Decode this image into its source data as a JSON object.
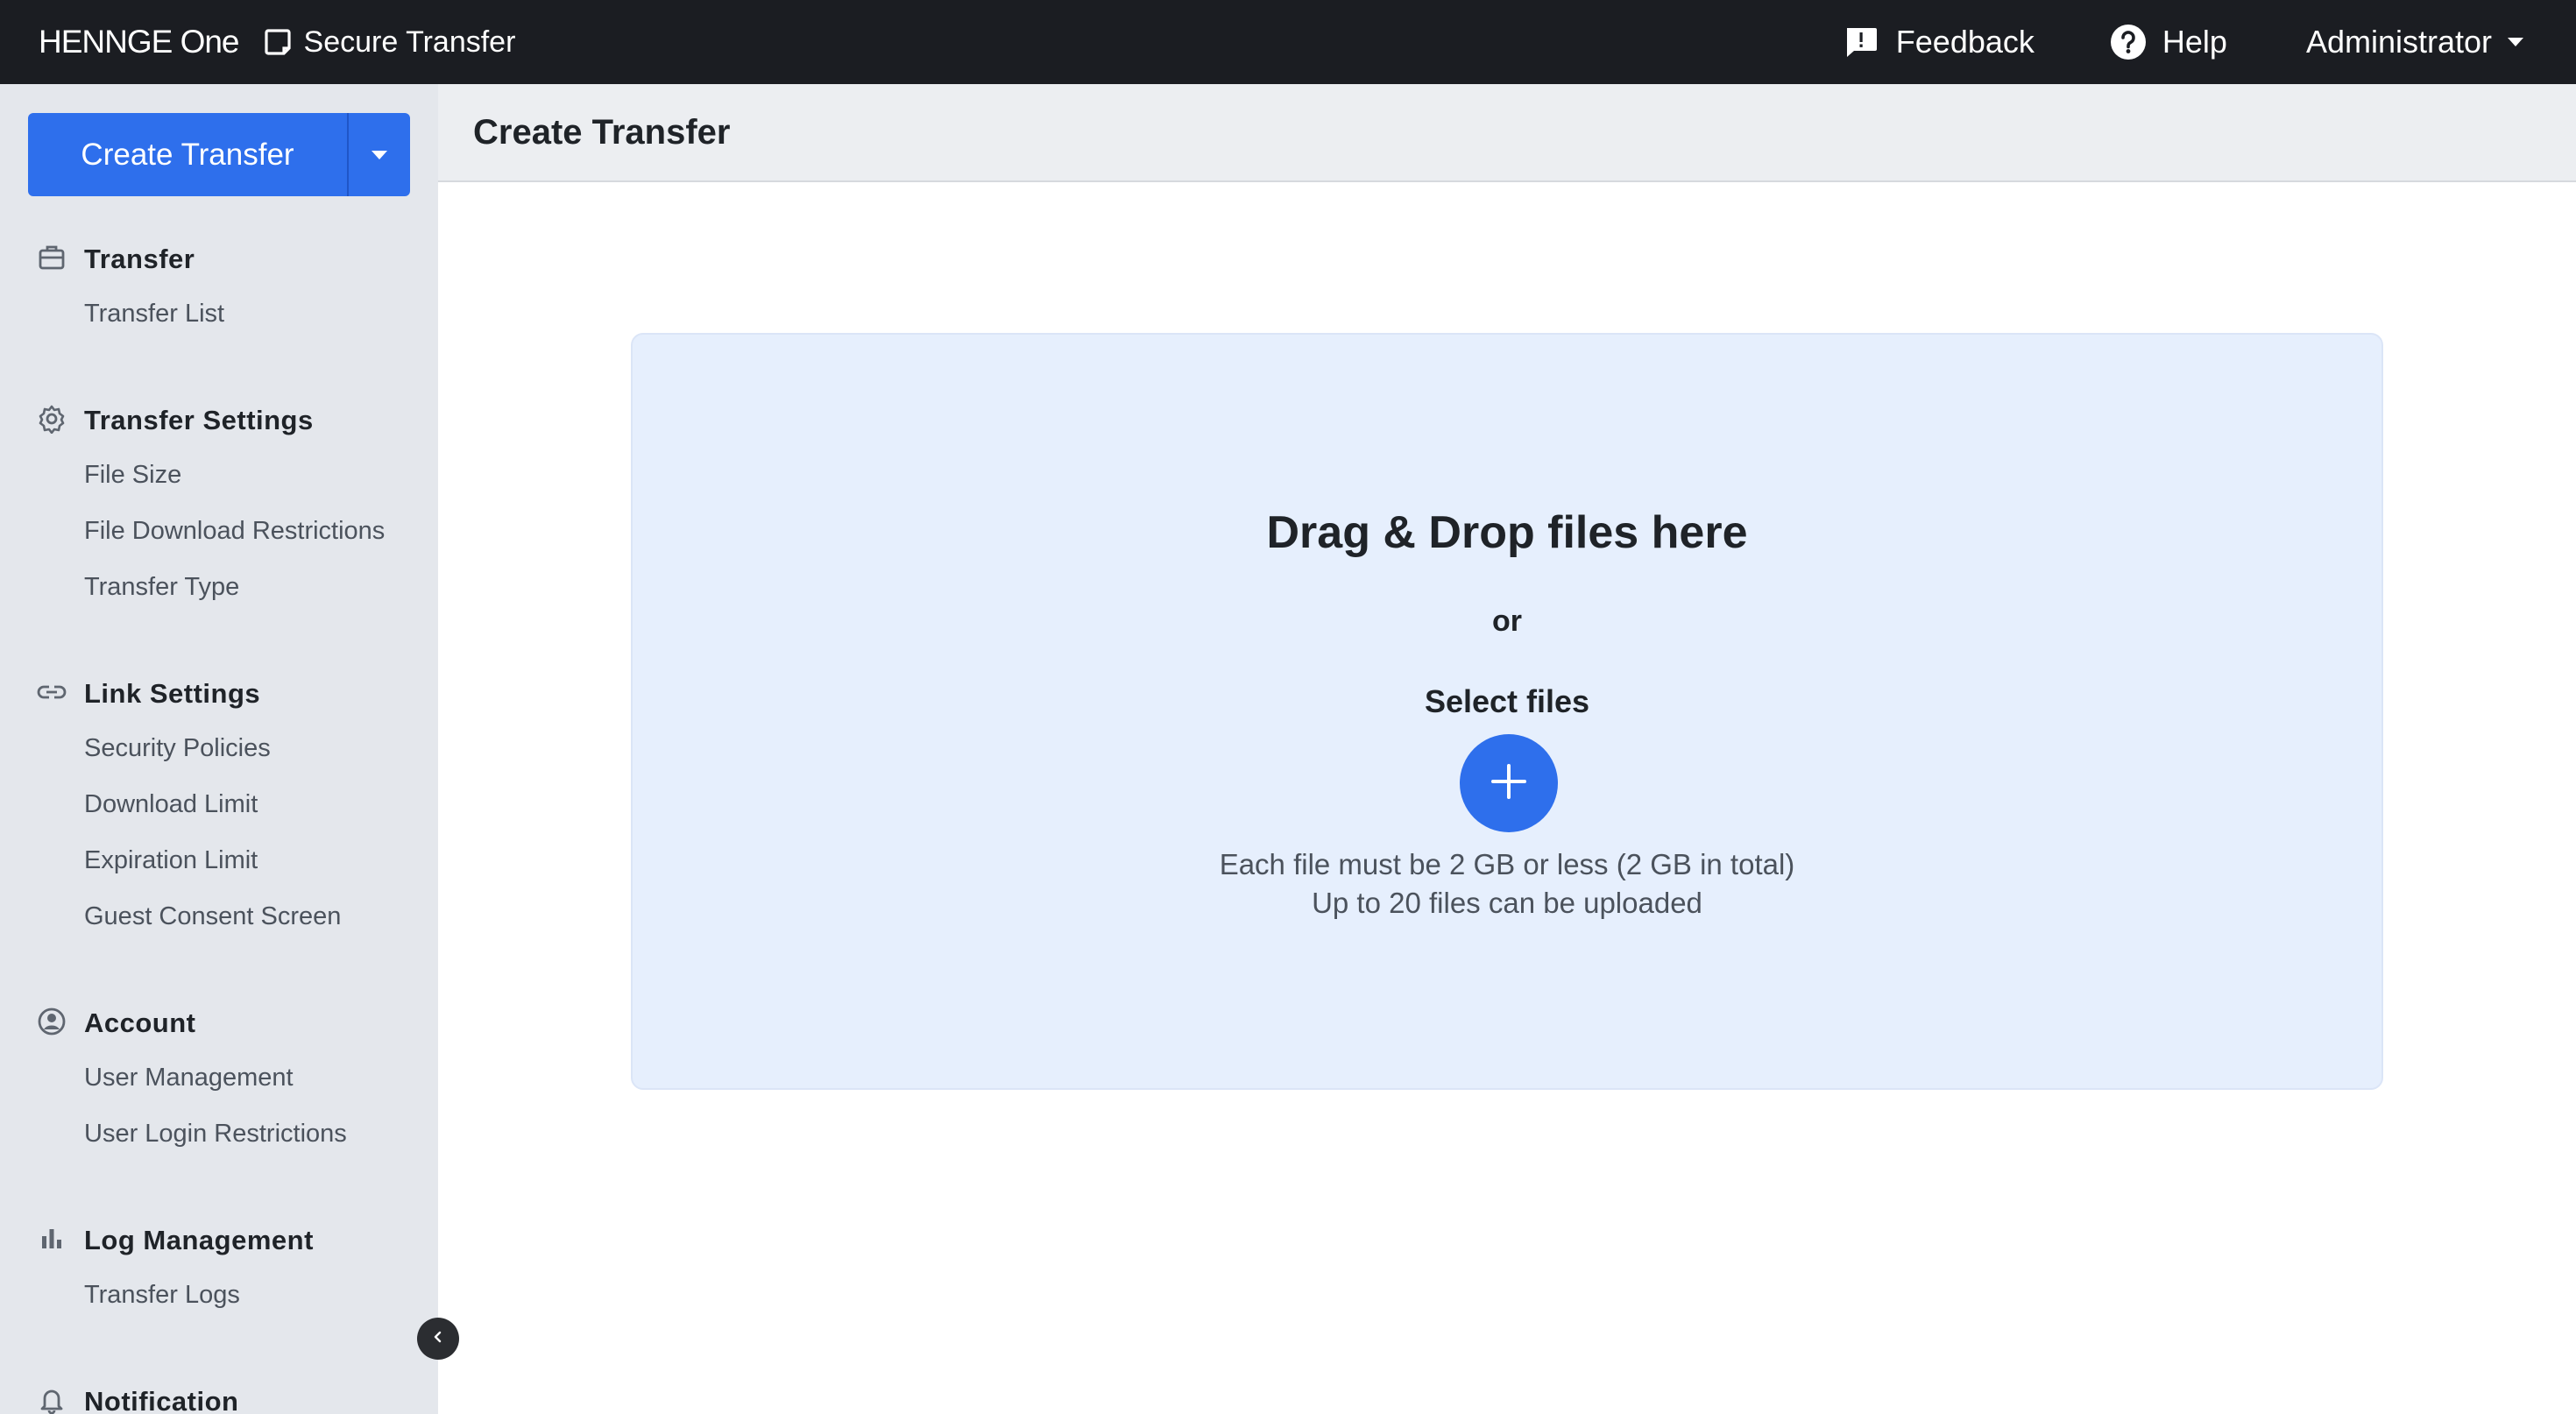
{
  "topbar": {
    "brand": "HENNGE One",
    "product": "Secure Transfer",
    "feedback_label": "Feedback",
    "help_label": "Help",
    "user_label": "Administrator"
  },
  "sidebar": {
    "create_button_label": "Create Transfer",
    "sections": [
      {
        "title": "Transfer",
        "icon": "briefcase-icon",
        "items": [
          "Transfer List"
        ]
      },
      {
        "title": "Transfer Settings",
        "icon": "gear-icon",
        "items": [
          "File Size",
          "File Download Restrictions",
          "Transfer Type"
        ]
      },
      {
        "title": "Link Settings",
        "icon": "link-icon",
        "items": [
          "Security Policies",
          "Download Limit",
          "Expiration Limit",
          "Guest Consent Screen"
        ]
      },
      {
        "title": "Account",
        "icon": "user-circle-icon",
        "items": [
          "User Management",
          "User Login Restrictions"
        ]
      },
      {
        "title": "Log Management",
        "icon": "bar-chart-icon",
        "items": [
          "Transfer Logs"
        ]
      },
      {
        "title": "Notification",
        "icon": "bell-icon",
        "items": []
      }
    ]
  },
  "main": {
    "title": "Create Transfer",
    "dropzone": {
      "title": "Drag & Drop files here",
      "or_text": "or",
      "select_label": "Select files",
      "note_size": "Each file must be 2 GB or less (2 GB in total)",
      "note_count": "Up to 20 files can be uploaded"
    }
  },
  "colors": {
    "topbar": "#1b1d22",
    "accent": "#2e6fec",
    "sidebar": "#e4e7ec",
    "dropzone": "#e6effd"
  }
}
